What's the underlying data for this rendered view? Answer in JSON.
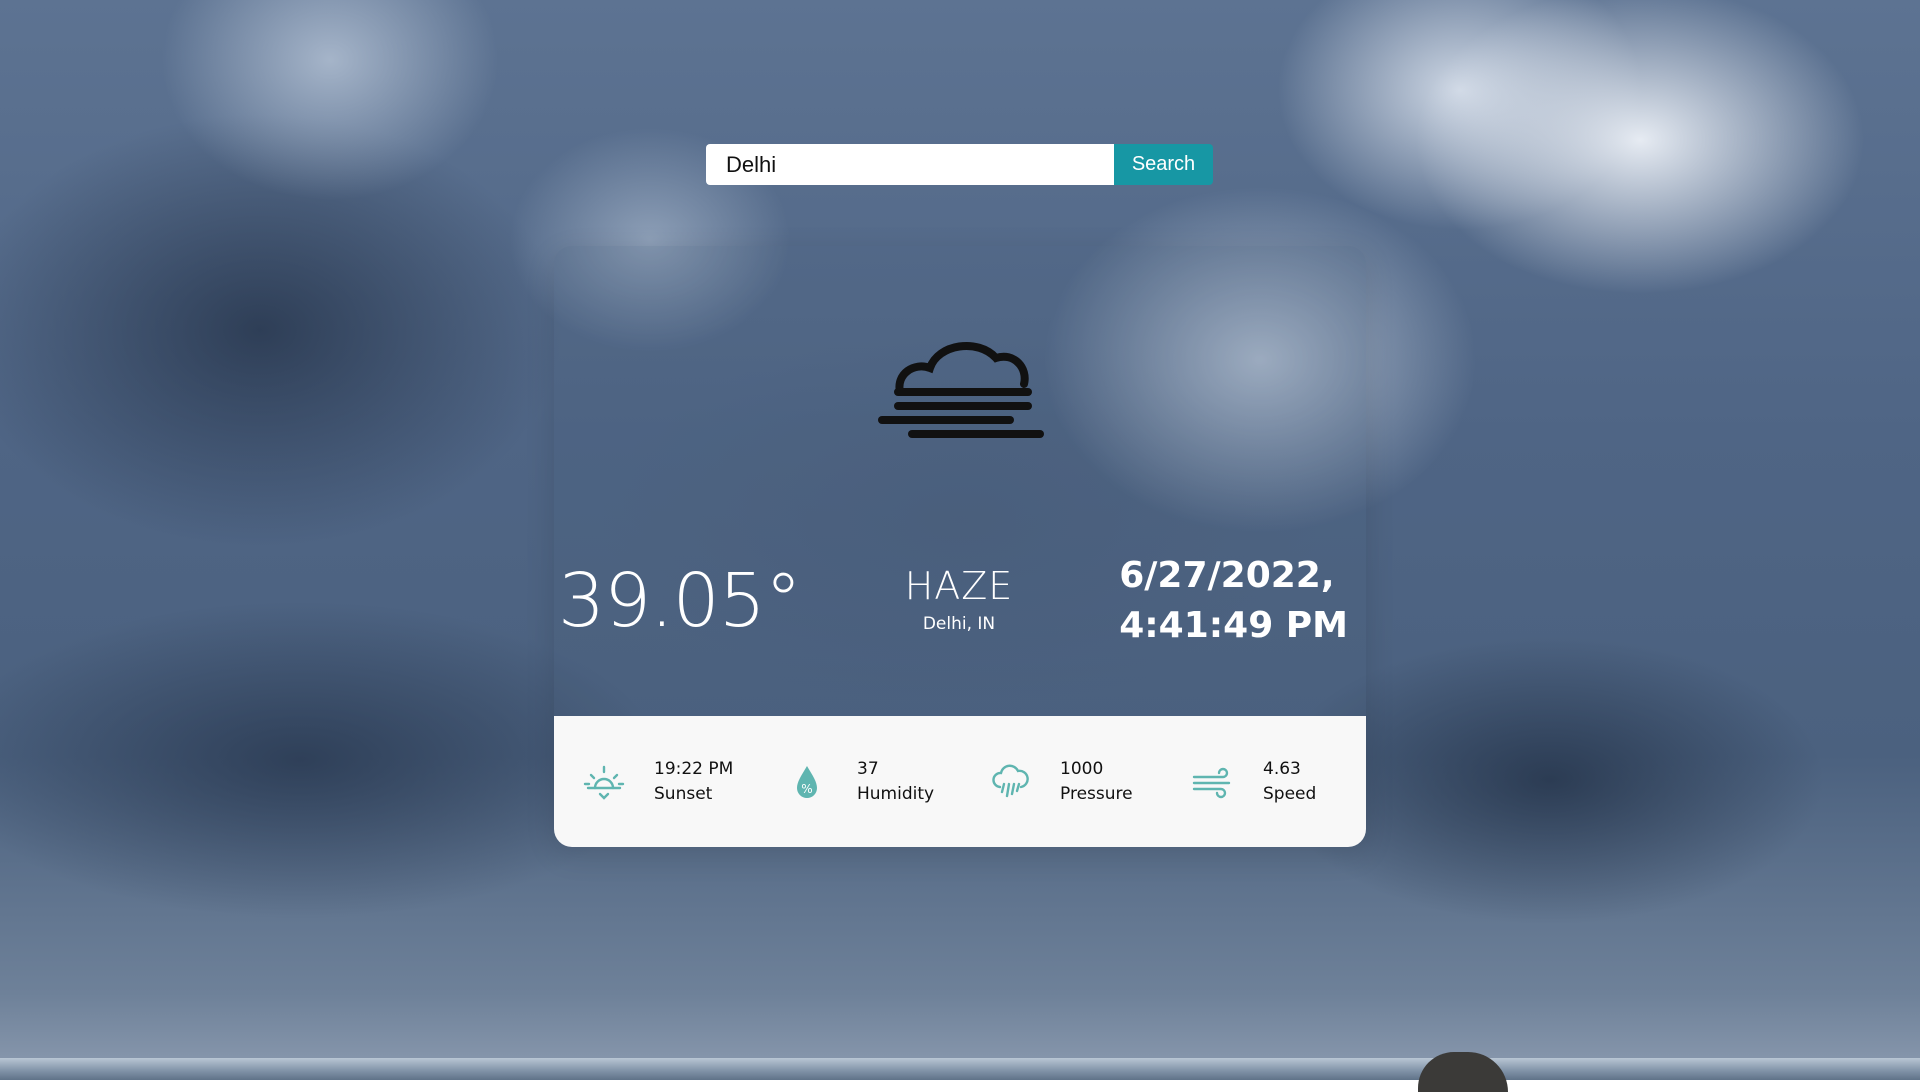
{
  "search": {
    "value": "Delhi",
    "button_label": "Search"
  },
  "weather": {
    "icon": "haze-icon",
    "temperature": "39.05°",
    "condition": "HAZE",
    "location": "Delhi, IN",
    "date": "6/27/2022,",
    "time": "4:41:49 PM"
  },
  "stats": [
    {
      "icon": "sunset-icon",
      "value": "19:22 PM",
      "label": "Sunset"
    },
    {
      "icon": "humidity-icon",
      "value": "37",
      "label": "Humidity"
    },
    {
      "icon": "pressure-icon",
      "value": "1000",
      "label": "Pressure"
    },
    {
      "icon": "wind-icon",
      "value": "4.63",
      "label": "Speed"
    }
  ],
  "colors": {
    "accent": "#1797a4",
    "icon_teal": "#5fb5b0",
    "panel": "#f8f8f8"
  }
}
